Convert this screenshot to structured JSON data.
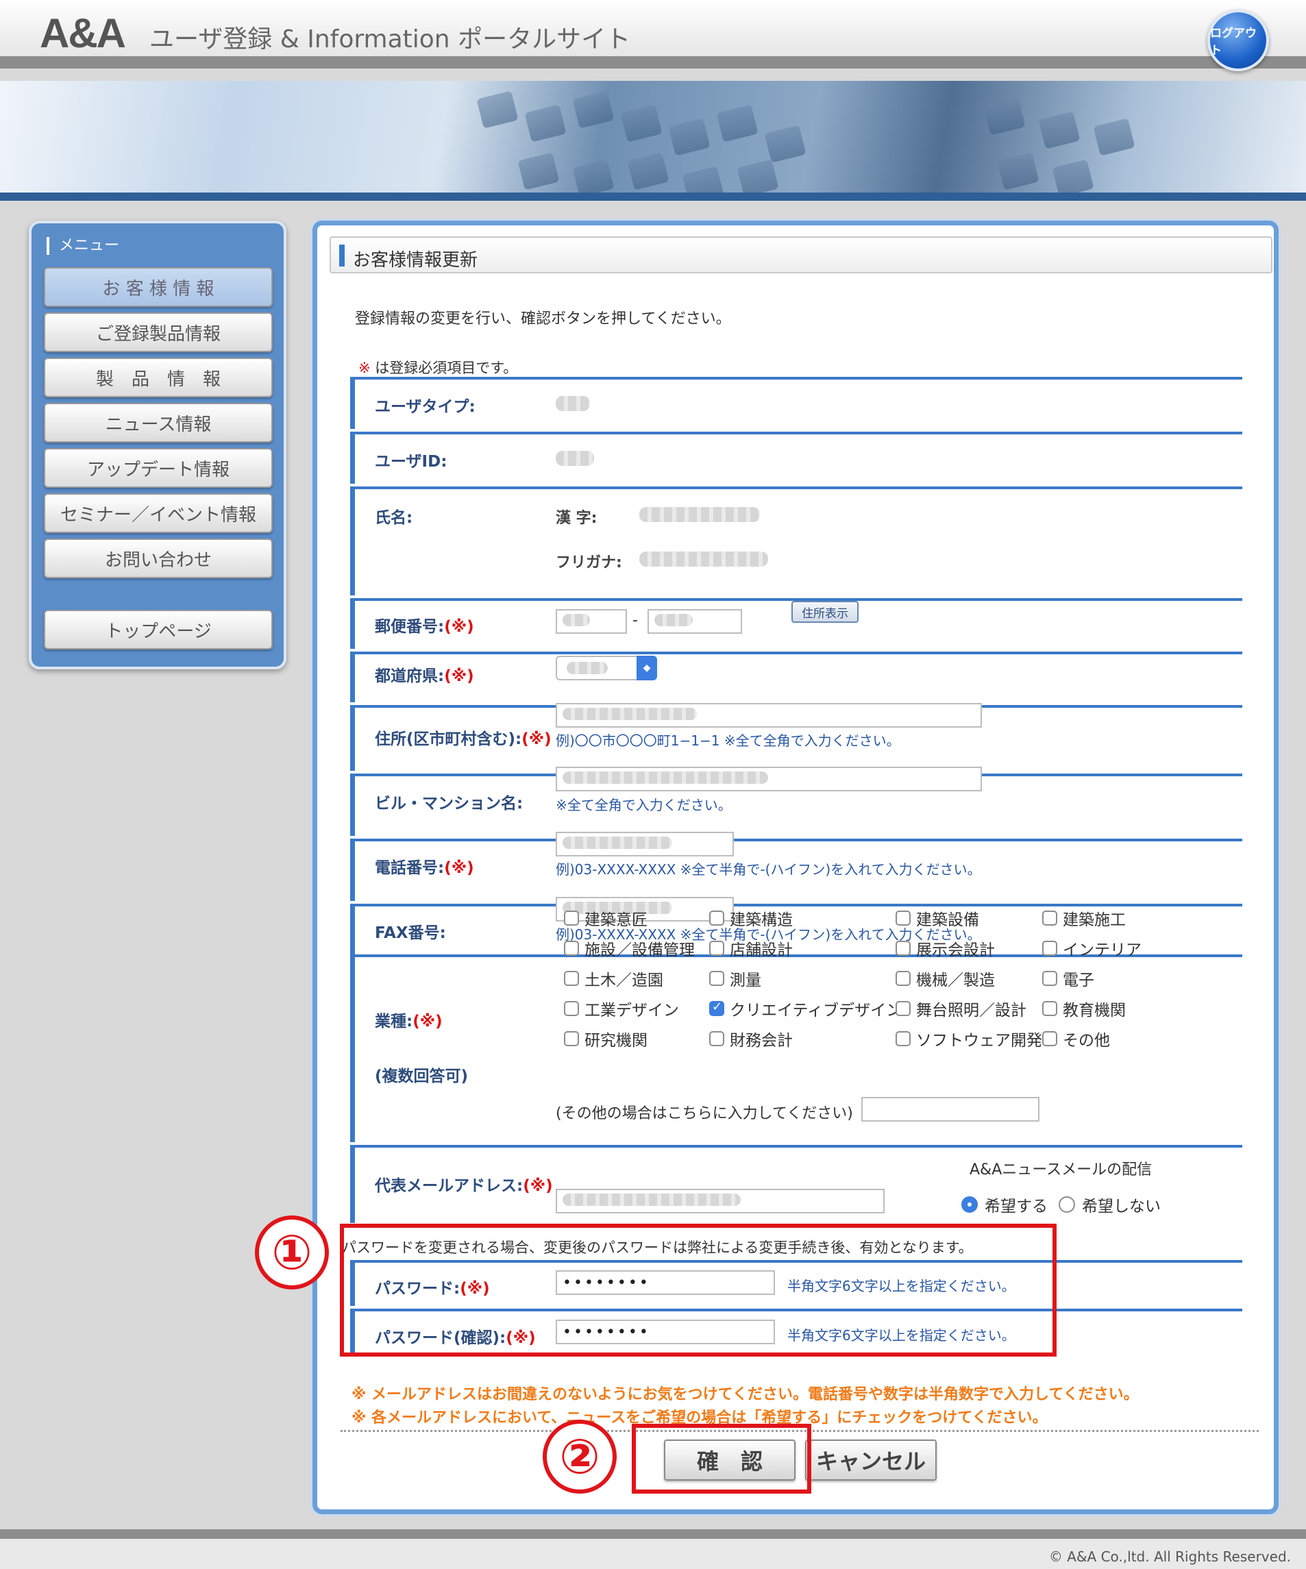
{
  "header": {
    "logo": "A&A",
    "site_title": "ユーザ登録 & Information ポータルサイト",
    "logout_label": "ログアウト"
  },
  "sidebar": {
    "title": "メニュー",
    "items": [
      {
        "label": "お 客 様 情 報",
        "active": true
      },
      {
        "label": "ご登録製品情報"
      },
      {
        "label": "製　品　情　報"
      },
      {
        "label": "ニュース情報"
      },
      {
        "label": "アップデート情報"
      },
      {
        "label": "セミナー／イベント情報"
      },
      {
        "label": "お問い合わせ"
      },
      {
        "label": "トップページ"
      }
    ]
  },
  "main": {
    "panel_title": "お客様情報更新",
    "lead": "登録情報の変更を行い、確認ボタンを押してください。",
    "required_mark": "※",
    "required_note": "は登録必須項目です。",
    "fields": {
      "user_type": "ユーザタイプ:",
      "user_id": "ユーザID:",
      "name": "氏名:",
      "kanji": "漢 字:",
      "furigana": "フリガナ:",
      "postal": "郵便番号:",
      "postal_dash": "-",
      "address_lookup": "住所表示",
      "prefecture": "都道府県:",
      "address": "住所(区市町村含む):",
      "address_hint": "例)〇〇市〇〇〇町1−1−1 ※全て全角で入力ください。",
      "building": "ビル・マンション名:",
      "building_hint": "※全て全角で入力ください。",
      "phone": "電話番号:",
      "phone_hint": "例)03-XXXX-XXXX ※全て半角で-(ハイフン)を入れて入力ください。",
      "fax": "FAX番号:",
      "fax_hint": "例)03-XXXX-XXXX ※全て半角で-(ハイフン)を入れて入力ください。",
      "industry": "業種:",
      "industry_sub": "(複数回答可)",
      "industry_other": "(その他の場合はこちらに入力してください)",
      "email": "代表メールアドレス:",
      "newsletter_title": "A&Aニュースメールの配信",
      "newsletter_yes": "希望する",
      "newsletter_no": "希望しない",
      "password_notice": "パスワードを変更される場合、変更後のパスワードは弊社による変更手続き後、有効となります。",
      "password": "パスワード:",
      "password_confirm": "パスワード(確認):",
      "password_value": "••••••••",
      "password_confirm_value": "••••••••",
      "password_hint": "半角文字6文字以上を指定ください。",
      "required_suffix": "(※)"
    },
    "industries": [
      [
        "建築意匠",
        "建築構造",
        "建築設備",
        "建築施工"
      ],
      [
        "施設／設備管理",
        "店舗設計",
        "展示会設計",
        "インテリア"
      ],
      [
        "土木／造園",
        "測量",
        "機械／製造",
        "電子"
      ],
      [
        "工業デザイン",
        "クリエイティブデザイン",
        "舞台照明／設計",
        "教育機関"
      ],
      [
        "研究機関",
        "財務会計",
        "ソフトウェア開発",
        "その他"
      ]
    ],
    "industry_checked": "クリエイティブデザイン",
    "notes": [
      "※ メールアドレスはお間違えのないようにお気をつけてください。電話番号や数字は半角数字で入力してください。",
      "※ 各メールアドレスにおいて、ニュースをご希望の場合は「希望する」にチェックをつけてください。"
    ],
    "confirm_label": "確　認",
    "cancel_label": "キャンセル",
    "annotation_1": "①",
    "annotation_2": "②"
  },
  "footer": {
    "copyright": "© A&A Co.,ltd. All Rights Reserved."
  },
  "colors": {
    "accent": "#3a78c8",
    "sidebar": "#5b8dc9",
    "required": "#dd1111",
    "annotation": "#e0141a",
    "note": "#f07b18"
  }
}
